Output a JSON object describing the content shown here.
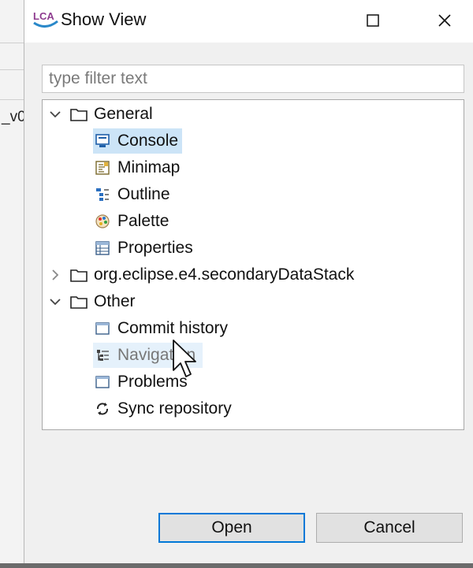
{
  "background": {
    "partial_text": "_v0"
  },
  "dialog": {
    "title": "Show View",
    "app_logo_text": "LCA"
  },
  "filter": {
    "placeholder": "type filter text",
    "value": ""
  },
  "tree": {
    "groups": [
      {
        "label": "General",
        "expanded": true,
        "items": [
          {
            "label": "Console",
            "icon": "console-icon",
            "state": "selected"
          },
          {
            "label": "Minimap",
            "icon": "minimap-icon"
          },
          {
            "label": "Outline",
            "icon": "outline-icon"
          },
          {
            "label": "Palette",
            "icon": "palette-icon"
          },
          {
            "label": "Properties",
            "icon": "properties-icon"
          }
        ]
      },
      {
        "label": "org.eclipse.e4.secondaryDataStack",
        "expanded": false,
        "items": []
      },
      {
        "label": "Other",
        "expanded": true,
        "items": [
          {
            "label": "Commit history",
            "icon": "view-window-icon"
          },
          {
            "label": "Navigation",
            "icon": "navigation-tree-icon",
            "state": "hover"
          },
          {
            "label": "Problems",
            "icon": "view-window-icon"
          },
          {
            "label": "Sync repository",
            "icon": "sync-icon"
          }
        ]
      }
    ]
  },
  "buttons": {
    "open": "Open",
    "cancel": "Cancel"
  },
  "colors": {
    "accent": "#0078d7",
    "selection": "#cce4f7",
    "hover": "#e5f1fb"
  }
}
